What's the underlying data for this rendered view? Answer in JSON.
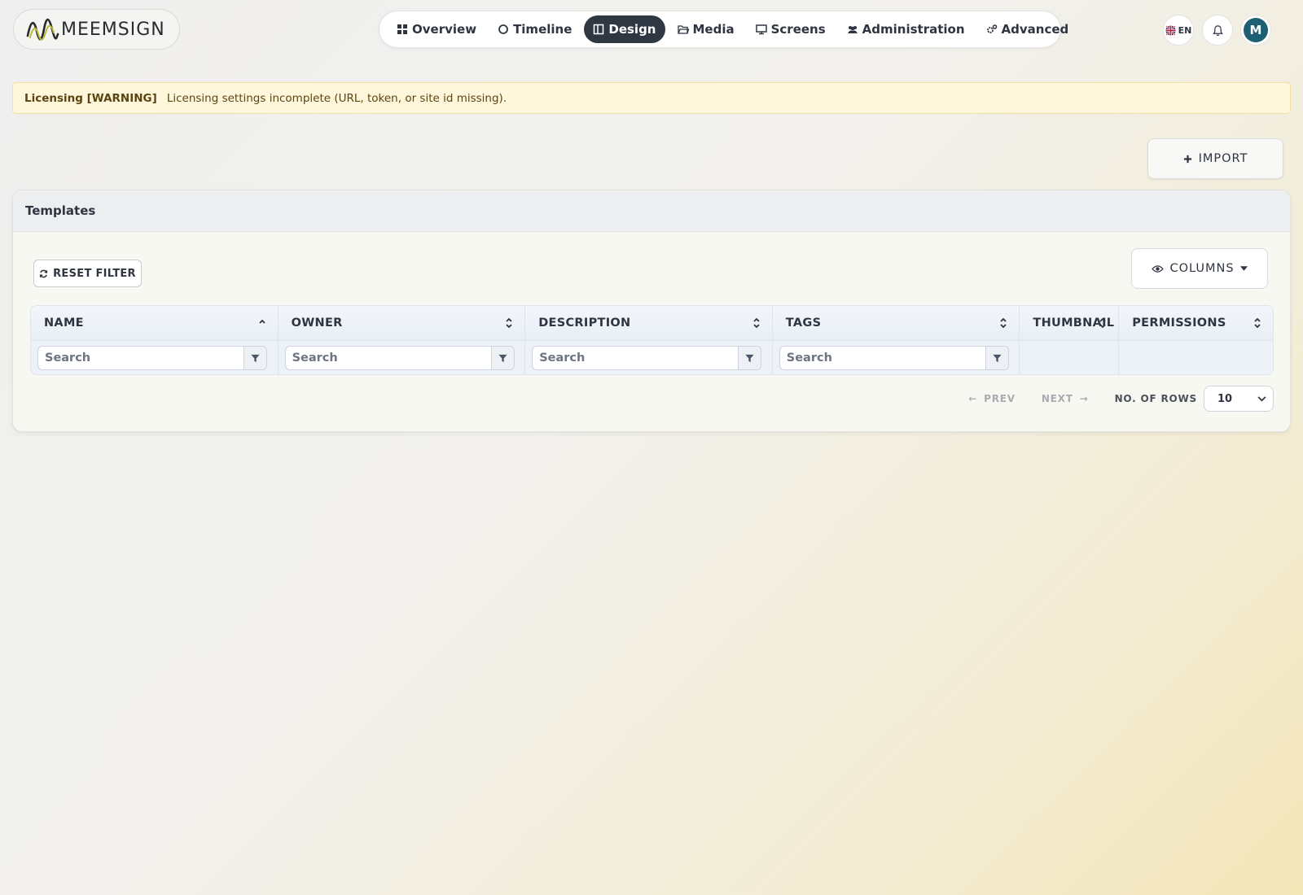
{
  "app": {
    "logo_text": "MEEMSIGN"
  },
  "nav": {
    "items": [
      {
        "label": "Overview",
        "icon": "grid-icon"
      },
      {
        "label": "Timeline",
        "icon": "circle-icon"
      },
      {
        "label": "Design",
        "icon": "layout-icon",
        "active": true
      },
      {
        "label": "Media",
        "icon": "folder-icon"
      },
      {
        "label": "Screens",
        "icon": "monitor-icon"
      },
      {
        "label": "Administration",
        "icon": "users-icon"
      },
      {
        "label": "Advanced",
        "icon": "gears-icon"
      }
    ]
  },
  "header_right": {
    "language": "EN",
    "avatar_initial": "M"
  },
  "banner": {
    "label": "Licensing [WARNING]",
    "message": "Licensing settings incomplete (URL, token, or site id missing)."
  },
  "actions": {
    "import_label": "IMPORT"
  },
  "card": {
    "title": "Templates"
  },
  "toolbar": {
    "reset_label": "RESET FILTER",
    "columns_label": "COLUMNS"
  },
  "table": {
    "columns": [
      {
        "label": "NAME",
        "sort": "asc",
        "searchable": true
      },
      {
        "label": "OWNER",
        "sort": "none",
        "searchable": true
      },
      {
        "label": "DESCRIPTION",
        "sort": "none",
        "searchable": true
      },
      {
        "label": "TAGS",
        "sort": "none",
        "searchable": true
      },
      {
        "label": "THUMBNAIL",
        "sort": "none",
        "searchable": false
      },
      {
        "label": "PERMISSIONS",
        "sort": "none",
        "searchable": false
      }
    ],
    "search_placeholder": "Search",
    "rows": []
  },
  "pagination": {
    "prev_label": "PREV",
    "next_label": "NEXT",
    "rows_label": "NO. OF ROWS",
    "rows_value": "10"
  },
  "colors": {
    "accent_dark": "#2f3742",
    "warning_bg": "#fff7dc",
    "avatar": "#1f5f73"
  }
}
